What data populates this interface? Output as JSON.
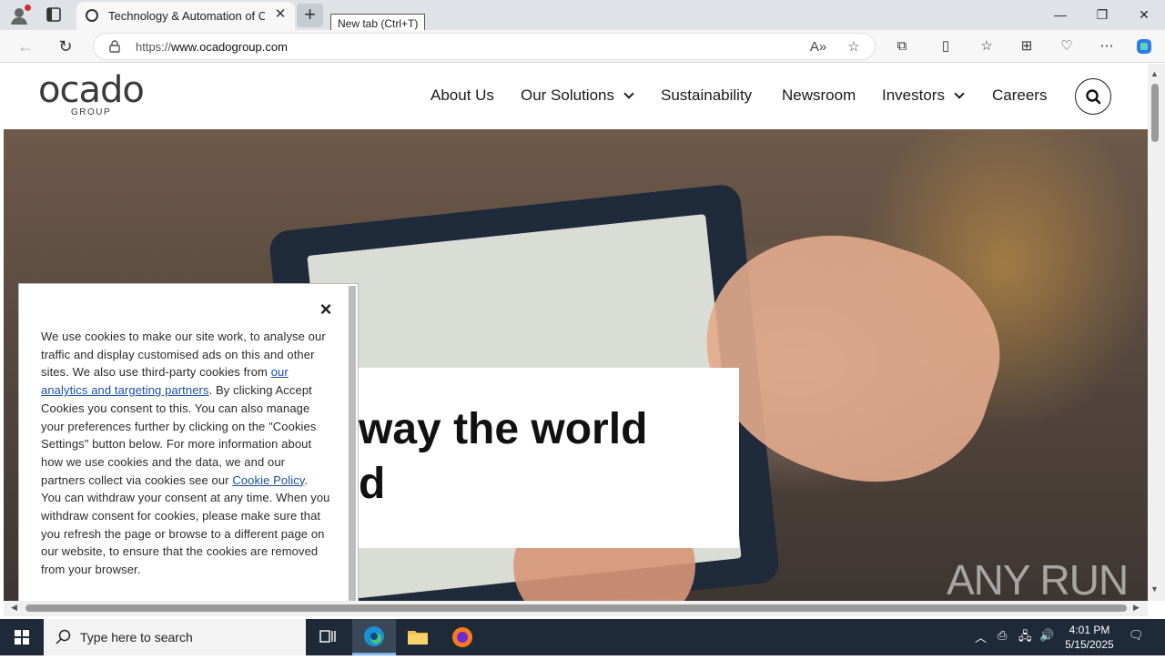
{
  "browser": {
    "tab_title": "Technology & Automation of Online Grocery",
    "new_tab_tooltip": "New tab (Ctrl+T)",
    "url_scheme": "https://",
    "url_host": "www.ocadogroup.com"
  },
  "site": {
    "logo_word": "ocado",
    "logo_sub": "GROUP",
    "nav": {
      "about": "About Us",
      "solutions": "Our Solutions",
      "sustainability": "Sustainability",
      "newsroom": "Newsroom",
      "investors": "Investors",
      "careers": "Careers"
    },
    "hero": {
      "line1": "way the world",
      "line2": "d"
    }
  },
  "cookie": {
    "text_1": "We use cookies to make our site work, to analyse our traffic and display customised ads on this and other sites. We also use third-party cookies from ",
    "link_partners": "our analytics and targeting partners",
    "text_2": ". By clicking Accept Cookies you consent to this. You can also manage your preferences further by clicking on the \"Cookies Settings\" button below. For more information about how we use cookies and the data, we and our partners collect via cookies see our ",
    "link_policy": "Cookie Policy",
    "text_3": ". You can withdraw your consent at any time. When you withdraw consent for cookies, please make sure that you refresh the page or browse to a different page on our website, to ensure that the cookies are removed from your browser."
  },
  "watermark": "ANY RUN",
  "taskbar": {
    "search_placeholder": "Type here to search",
    "time": "4:01 PM",
    "date": "5/15/2025"
  },
  "colors": {
    "tabstrip": "#dfe3e8",
    "taskbar": "#1e2a38",
    "link": "#1a4fa0"
  }
}
